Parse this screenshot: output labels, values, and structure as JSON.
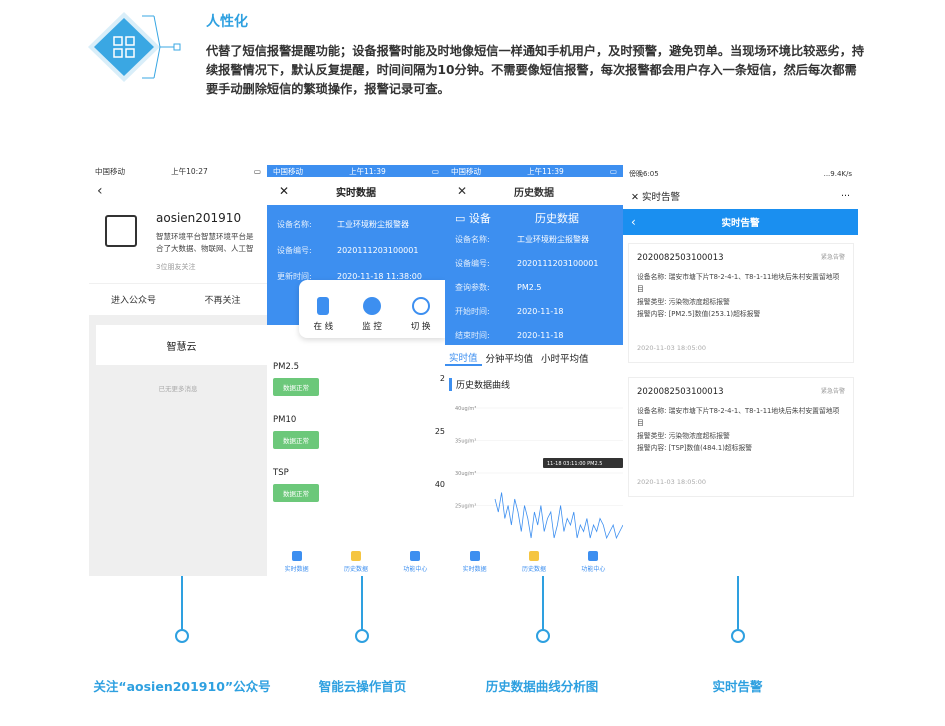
{
  "header": {
    "title": "人性化",
    "body": "代替了短信报警提醒功能；设备报警时能及时地像短信一样通知手机用户，及时预警，避免罚单。当现场环境比较恶劣，持续报警情况下，默认反复提醒，时间间隔为10分钟。不需要像短信报警，每次报警都会用户存入一条短信，然后每次都需要手动删除短信的繁琐操作，报警记录可查。"
  },
  "phone1": {
    "status_left": "中国移动",
    "status_time": "上午10:27",
    "back": "‹",
    "account": "aosien201910",
    "desc1": "智慧环境平台智慧环境平台是",
    "desc2": "合了大数据、物联网、人工智",
    "friends": "3位朋友关注",
    "enter": "进入公众号",
    "unfollow": "不再关注",
    "card": "智慧云",
    "nomore": "已无更多消息"
  },
  "phone2": {
    "status_left": "中国移动",
    "status_time": "上午11:39",
    "close": "✕",
    "title": "实时数据",
    "info": [
      {
        "k": "设备名称:",
        "v": "工业环境粉尘报警器"
      },
      {
        "k": "设备编号:",
        "v": "2020111203100001"
      },
      {
        "k": "更新时间:",
        "v": "2020-11-18 11:38:00"
      }
    ],
    "menu": [
      "在 线",
      "监 控",
      "切 换"
    ],
    "rows": [
      {
        "name": "PM2.5",
        "badge": "数据正常",
        "value": "2"
      },
      {
        "name": "PM10",
        "badge": "数据正常",
        "value": "25"
      },
      {
        "name": "TSP",
        "badge": "数据正常",
        "value": "40"
      }
    ],
    "tabs": [
      "实时数据",
      "历史数据",
      "功能中心"
    ]
  },
  "phone3": {
    "status_left": "中国移动",
    "status_time": "上午11:39",
    "close": "✕",
    "title": "历史数据",
    "tab1": "设备",
    "tab2": "历史数据",
    "info": [
      {
        "k": "设备名称:",
        "v": "工业环境粉尘报警器"
      },
      {
        "k": "设备编号:",
        "v": "2020111203100001"
      },
      {
        "k": "查询参数:",
        "v": "PM2.5"
      },
      {
        "k": "开始时间:",
        "v": "2020-11-18"
      },
      {
        "k": "结束时间:",
        "v": "2020-11-18"
      }
    ],
    "tabs": [
      "实时值",
      "分钟平均值",
      "小时平均值"
    ],
    "chart_title": "历史数据曲线",
    "tooltip": "11-18 03:11:00 PM2.5",
    "bottom_tabs": [
      "实时数据",
      "历史数据",
      "功能中心"
    ]
  },
  "chart_data": {
    "type": "line",
    "title": "历史数据曲线",
    "ylabel": "",
    "yticks": [
      "40ug/m³",
      "35ug/m³",
      "30ug/m³",
      "25ug/m³"
    ],
    "ylim": [
      20,
      40
    ],
    "series": [
      {
        "values": [
          26,
          24,
          27,
          23,
          25,
          22,
          26,
          24,
          21,
          25,
          23,
          20,
          24,
          22,
          25,
          21,
          23,
          24,
          20,
          22,
          25,
          21,
          23,
          22,
          24,
          20,
          22,
          21,
          23,
          20,
          22,
          21,
          23,
          22,
          20,
          21,
          22,
          20,
          21,
          22
        ]
      }
    ]
  },
  "phone4": {
    "status_left": "傍晚6:05",
    "status_right": "...9.4K/s",
    "nav_title": "实时告警",
    "more": "···",
    "bar_title": "实时告警",
    "alarms": [
      {
        "id": "2020082503100013",
        "level": "紧急告警",
        "line1": "设备名称: 瑞安市塘下片T8-2-4-1、T8-1-11地块后朱村安置留地项目",
        "line2": "报警类型: 污染物浓度超标报警",
        "line3": "报警内容: [PM2.5]数值(253.1)超标报警",
        "time": "2020-11-03 18:05:00"
      },
      {
        "id": "2020082503100013",
        "level": "紧急告警",
        "line1": "设备名称: 瑞安市塘下片T8-2-4-1、T8-1-11地块后朱村安置留地项目",
        "line2": "报警类型: 污染物浓度超标报警",
        "line3": "报警内容: [TSP]数值(484.1)超标报警",
        "time": "2020-11-03 18:05:00"
      }
    ]
  },
  "captions": [
    "关注“aosien201910”公众号",
    "智能云操作首页",
    "历史数据曲线分析图",
    "实时告警"
  ],
  "colors": {
    "accent": "#2ea0e0",
    "blue": "#3d8ff0",
    "green": "#6cc87a"
  }
}
